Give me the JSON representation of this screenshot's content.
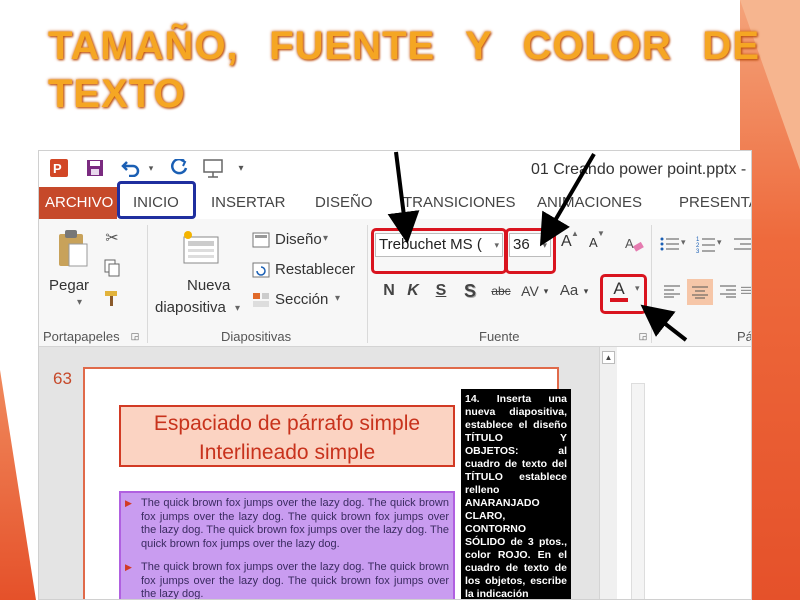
{
  "slide": {
    "title": "TAMAÑO, FUENTE Y COLOR DE TEXTO"
  },
  "window": {
    "document_title": "01 Creando power point.pptx -"
  },
  "quick_access": {
    "icons": [
      "powerpoint-logo",
      "save-icon",
      "undo-icon",
      "redo-icon",
      "start-presentation-icon",
      "customize-icon"
    ]
  },
  "tabs": [
    {
      "label": "ARCHIVO"
    },
    {
      "label": "INICIO"
    },
    {
      "label": "INSERTAR"
    },
    {
      "label": "DISEÑO"
    },
    {
      "label": "TRANSICIONES"
    },
    {
      "label": "ANIMACIONES"
    },
    {
      "label": "PRESENTA"
    }
  ],
  "ribbon": {
    "clipboard": {
      "paste_label": "Pegar",
      "group_label": "Portapapeles"
    },
    "slides": {
      "new_slide_line1": "Nueva",
      "new_slide_line2": "diapositiva",
      "layout_label": "Diseño",
      "reset_label": "Restablecer",
      "section_label": "Sección",
      "group_label": "Diapositivas"
    },
    "font": {
      "font_name": "Trebuchet MS (",
      "font_size": "36",
      "bold": "N",
      "italic": "K",
      "underline": "S",
      "shadow": "S",
      "strikethrough": "abc",
      "spacing": "AV",
      "change_case": "Aa",
      "grow": "A",
      "shrink": "A",
      "font_color_letter": "A",
      "font_color": "#d9141f",
      "group_label": "Fuente"
    },
    "paragraph": {
      "group_label": "Pá"
    }
  },
  "editor": {
    "slide_number": "63",
    "thumb_title_line1": "Espaciado de párrafo simple",
    "thumb_title_line2": "Interlineado simple",
    "thumb_body_p1": "The quick brown fox jumps over the lazy dog. The quick brown fox jumps over the lazy dog. The quick brown fox jumps over the lazy dog. The quick brown fox jumps over the lazy dog. The quick brown fox jumps over the lazy dog.",
    "thumb_body_p2": "The quick brown fox jumps over the lazy dog. The quick brown fox jumps over the lazy dog. The quick brown fox jumps over the lazy dog.",
    "thumb_note": "14. Inserta una nueva diapositiva, establece el diseño TÍTULO Y OBJETOS: al cuadro de texto del TÍTULO establece relleno ANARANJADO CLARO, CONTORNO SÓLIDO de 3 ptos., color ROJO. En el cuadro de texto de los objetos, escribe la indicación"
  },
  "colors": {
    "title_orange": "#f5a623",
    "file_tab": "#c6492a",
    "highlight_red": "#d9141f",
    "highlight_blue": "#1f2f9f"
  }
}
